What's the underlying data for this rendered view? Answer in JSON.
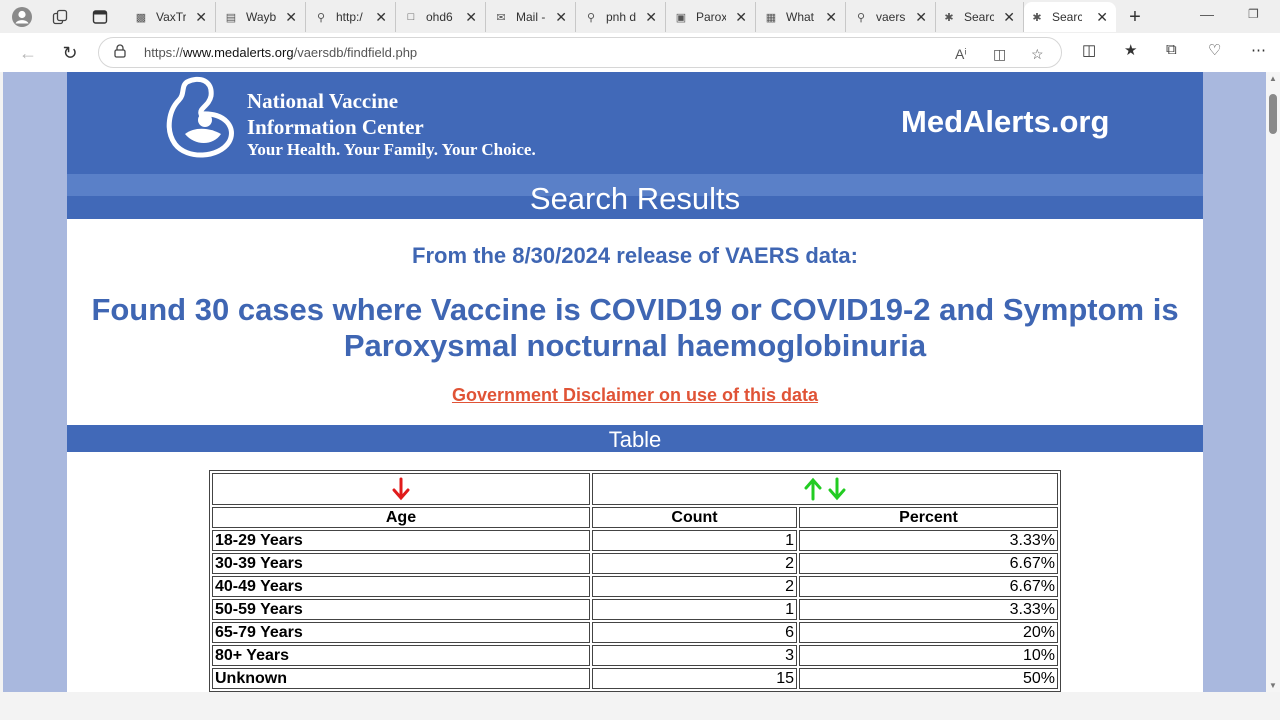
{
  "browser": {
    "tabs": [
      {
        "title": "VaxTr",
        "icon": "page-icon"
      },
      {
        "title": "Wayb",
        "icon": "archive-icon"
      },
      {
        "title": "http:/",
        "icon": "search-icon"
      },
      {
        "title": "ohd6",
        "icon": "document-icon"
      },
      {
        "title": "Mail -",
        "icon": "mail-icon"
      },
      {
        "title": "pnh d",
        "icon": "search-icon"
      },
      {
        "title": "Parox",
        "icon": "site-icon"
      },
      {
        "title": "What",
        "icon": "image-icon"
      },
      {
        "title": "vaers",
        "icon": "search-icon"
      },
      {
        "title": "Searc",
        "icon": "nvic-icon"
      },
      {
        "title": "Searc",
        "icon": "nvic-icon",
        "active": true
      }
    ],
    "url_prefix": "https://",
    "url_host": "www.medalerts.org",
    "url_path": "/vaersdb/findfield.php"
  },
  "header": {
    "org_line1": "National Vaccine",
    "org_line2": "Information Center",
    "tagline": "Your Health. Your Family. Your Choice.",
    "site_name": "MedAlerts.org"
  },
  "results": {
    "heading": "Search Results",
    "release": "From the 8/30/2024 release of VAERS data:",
    "found_line1": "Found 30 cases where Vaccine is COVID19 or COVID19-2 and Symptom is",
    "found_line2": "Paroxysmal nocturnal haemoglobinuria",
    "disclaimer": "Government Disclaimer on use of this data"
  },
  "table": {
    "heading": "Table",
    "columns": [
      "Age",
      "Count",
      "Percent"
    ],
    "rows": [
      {
        "age": "18-29 Years",
        "count": "1",
        "percent": "3.33%"
      },
      {
        "age": "30-39 Years",
        "count": "2",
        "percent": "6.67%"
      },
      {
        "age": "40-49 Years",
        "count": "2",
        "percent": "6.67%"
      },
      {
        "age": "50-59 Years",
        "count": "1",
        "percent": "3.33%"
      },
      {
        "age": "65-79 Years",
        "count": "6",
        "percent": "20%"
      },
      {
        "age": "80+ Years",
        "count": "3",
        "percent": "10%"
      },
      {
        "age": "Unknown",
        "count": "15",
        "percent": "50%"
      }
    ]
  },
  "colors": {
    "banner": "#4169b8",
    "heading_text": "#3f66b3",
    "disclaimer": "#e05336",
    "sort_down_active": "#e01b1b",
    "sort_green": "#22cc22"
  }
}
